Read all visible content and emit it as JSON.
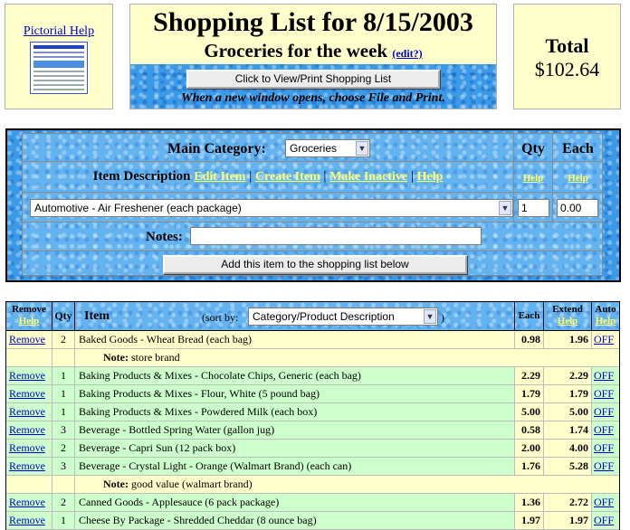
{
  "help_box": {
    "link": "Pictorial Help"
  },
  "header": {
    "title": "Shopping List for 8/15/2003",
    "subtitle": "Groceries for the week",
    "edit_link": "(edit?)",
    "view_print_button": "Click to View/Print Shopping List",
    "instruction": "When a new window opens, choose File and Print."
  },
  "total": {
    "label": "Total",
    "amount": "$102.64"
  },
  "form": {
    "main_category_label": "Main Category:",
    "main_category_value": "Groceries",
    "qty_header": "Qty",
    "each_header": "Each",
    "item_description_label": "Item Description",
    "links": {
      "edit_item": "Edit Item",
      "create_item": "Create Item",
      "make_inactive": "Make Inactive",
      "help": "Help",
      "sep": "|"
    },
    "qty_help": "Help",
    "each_help": "Help",
    "item_select_value": "Automotive - Air Freshener (each package)",
    "qty_value": "1",
    "each_value": "0.00",
    "notes_label": "Notes:",
    "notes_value": "",
    "add_button": "Add this item to the shopping list below"
  },
  "list": {
    "headers": {
      "remove": "Remove",
      "remove_help": "Help",
      "qty": "Qty",
      "item": "Item",
      "sort_by": "(sort by:",
      "sort_value": "Category/Product Description",
      "sort_close": ")",
      "each": "Each",
      "extend": "Extend",
      "extend_help": "Help",
      "auto": "Auto",
      "auto_help": "Help"
    },
    "rows": [
      {
        "remove": "Remove",
        "qty": "2",
        "item": "Baked Goods - Wheat Bread (each bag)",
        "each": "0.98",
        "extend": "1.96",
        "auto": "OFF"
      },
      {
        "note_label": "Note:",
        "note": "store brand"
      },
      {
        "remove": "Remove",
        "qty": "1",
        "item": "Baking Products & Mixes - Chocolate Chips, Generic (each bag)",
        "each": "2.29",
        "extend": "2.29",
        "auto": "OFF"
      },
      {
        "remove": "Remove",
        "qty": "1",
        "item": "Baking Products & Mixes - Flour, White (5 pound bag)",
        "each": "1.79",
        "extend": "1.79",
        "auto": "OFF"
      },
      {
        "remove": "Remove",
        "qty": "1",
        "item": "Baking Products & Mixes - Powdered Milk (each box)",
        "each": "5.00",
        "extend": "5.00",
        "auto": "OFF"
      },
      {
        "remove": "Remove",
        "qty": "3",
        "item": "Beverage - Bottled Spring Water (gallon jug)",
        "each": "0.58",
        "extend": "1.74",
        "auto": "OFF"
      },
      {
        "remove": "Remove",
        "qty": "2",
        "item": "Beverage - Capri Sun (12 pack box)",
        "each": "2.00",
        "extend": "4.00",
        "auto": "OFF"
      },
      {
        "remove": "Remove",
        "qty": "3",
        "item": "Beverage - Crystal Light - Orange (Walmart Brand) (each can)",
        "each": "1.76",
        "extend": "5.28",
        "auto": "OFF"
      },
      {
        "note_label": "Note:",
        "note": "good value (walmart brand)"
      },
      {
        "remove": "Remove",
        "qty": "2",
        "item": "Canned Goods - Applesauce (6 pack package)",
        "each": "1.36",
        "extend": "2.72",
        "auto": "OFF"
      },
      {
        "remove": "Remove",
        "qty": "1",
        "item": "Cheese By Package - Shredded Cheddar (8 ounce bag)",
        "each": "1.97",
        "extend": "1.97",
        "auto": "OFF"
      }
    ]
  }
}
